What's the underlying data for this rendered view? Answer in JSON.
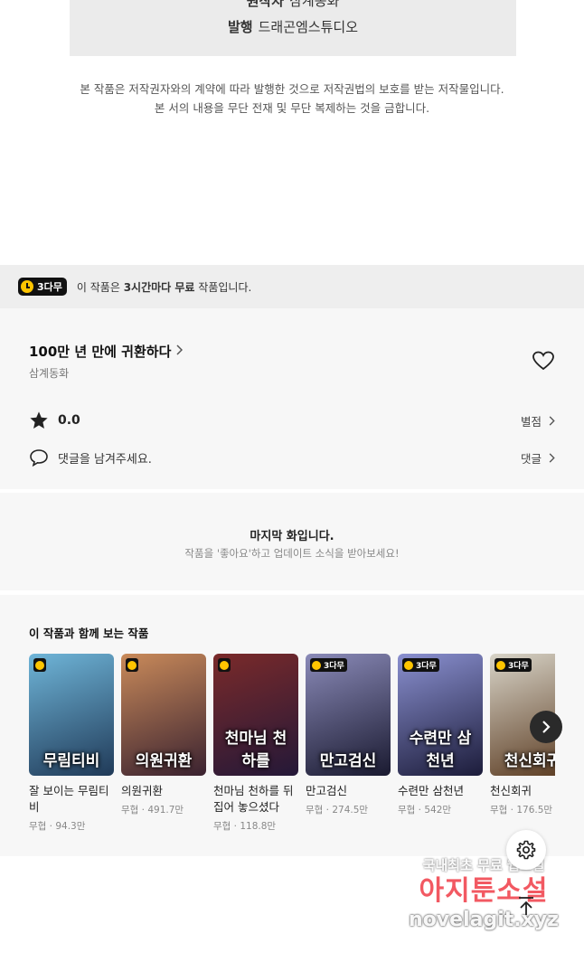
{
  "credits": {
    "original_label": "원작자",
    "original_value": "삼계동화",
    "publisher_label": "발행",
    "publisher_value": "드래곤엠스튜디오"
  },
  "copyright": {
    "line1": "본 작품은 저작권자와의 계약에 따라 발행한 것으로 저작권법의 보호를 받는 저작물입니다.",
    "line2": "본 서의 내용을 무단 전재 및 무단 복제하는 것을 금합니다."
  },
  "free_bar": {
    "badge": "3다무",
    "text_pre": "이 작품은 ",
    "text_bold": "3시간마다 무료",
    "text_post": " 작품입니다."
  },
  "work": {
    "title": "100만 년 만에 귀환하다",
    "author": "삼계동화",
    "rating": "0.0",
    "rate_link": "별점",
    "comment_prompt": "댓글을 남겨주세요.",
    "comment_link": "댓글"
  },
  "last_episode": {
    "title": "마지막 화입니다.",
    "subtitle": "작품을 '좋아요'하고 업데이트 소식을 받아보세요!"
  },
  "recommend": {
    "heading": "이 작품과 함께 보는 작품",
    "items": [
      {
        "name": "잘 보이는 무림티비",
        "meta": "무협 · 94.3만",
        "badge": "",
        "cover_text": "무림티비",
        "colors": [
          "#6fb5d8",
          "#203a58"
        ]
      },
      {
        "name": "의원귀환",
        "meta": "무협 · 491.7만",
        "badge": "",
        "cover_text": "의원귀환",
        "colors": [
          "#c98a5a",
          "#3a2230"
        ]
      },
      {
        "name": "천마님 천하를 뒤집어 놓으셨다",
        "meta": "무협 · 118.8만",
        "badge": "",
        "cover_text": "천마님 천하를",
        "colors": [
          "#7a2a2a",
          "#241838"
        ]
      },
      {
        "name": "만고검신",
        "meta": "무협 · 274.5만",
        "badge": "3다무",
        "cover_text": "만고검신",
        "colors": [
          "#8a8ab8",
          "#1a1a30"
        ]
      },
      {
        "name": "수련만 삼천년",
        "meta": "무협 · 542만",
        "badge": "3다무",
        "cover_text": "수련만 삼천년",
        "colors": [
          "#8a90d0",
          "#1c1c3a"
        ]
      },
      {
        "name": "천신회귀",
        "meta": "무협 · 176.5만",
        "badge": "3다무",
        "cover_text": "천신회귀",
        "colors": [
          "#d8d4c8",
          "#5a3a20"
        ]
      }
    ]
  },
  "watermark": {
    "line1": "국내최초 무료 웹소설",
    "line2": "아지툰소설",
    "line3": "novelagit.xyz"
  },
  "icons": {
    "chevron": "chevron-right-icon",
    "heart": "heart-icon",
    "star": "star-icon",
    "comment": "comment-icon",
    "settings": "gear-icon",
    "top": "arrow-up-icon",
    "clock": "clock-icon"
  },
  "colors": {
    "accent": "#ffc500",
    "badge_bg": "#111111",
    "panel_bg": "#f7f7f7"
  }
}
